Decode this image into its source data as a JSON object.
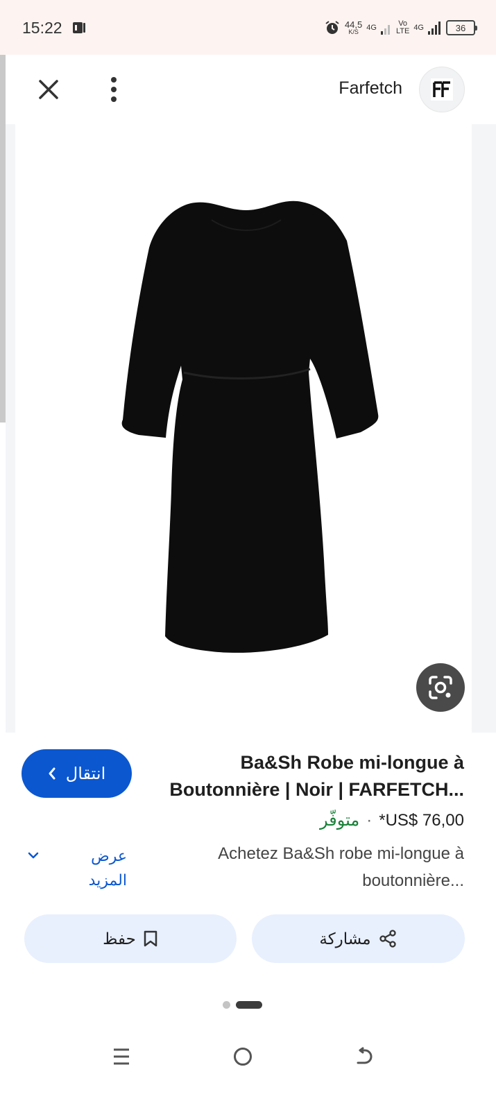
{
  "status_bar": {
    "time": "15:22",
    "net_speed_value": "44,5",
    "net_speed_unit": "K/S",
    "signal1_label": "4G",
    "volte_top": "Vo",
    "volte_bottom": "LTE",
    "signal2_label": "4G",
    "battery": "36"
  },
  "app_bar": {
    "site_name": "Farfetch",
    "logo_text": "FF"
  },
  "product": {
    "title": "Ba&Sh Robe mi-longue à Boutonnière | Noir | FARFETCH...",
    "visit_label": "انتقال",
    "price": "*US$ 76,00",
    "separator": "·",
    "availability": "متوفّر",
    "description": "Achetez Ba&Sh robe mi-longue à boutonnière...",
    "more_label": "عرض المزيد"
  },
  "actions": {
    "save_label": "حفظ",
    "share_label": "مشاركة"
  },
  "colors": {
    "accent": "#0b57d0",
    "availability": "#188038",
    "action_bg": "#e8f0fe",
    "status_bg": "#fdf4f1"
  },
  "icons": [
    "close-icon",
    "more-vert-icon",
    "lens-icon",
    "chevron-right-icon",
    "chevron-down-icon",
    "bookmark-icon",
    "share-icon",
    "menu-icon",
    "home-icon",
    "back-icon",
    "alarm-icon"
  ]
}
